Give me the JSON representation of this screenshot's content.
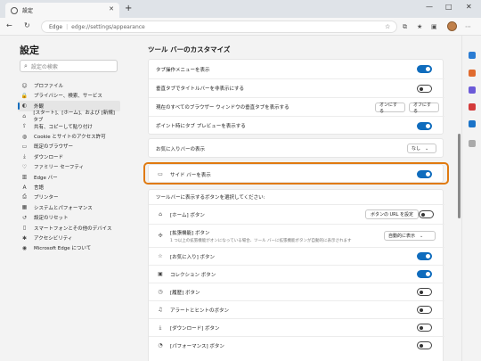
{
  "browser": {
    "tab_title": "設定",
    "address_site": "Edge",
    "address_url": "edge://settings/appearance"
  },
  "leftnav": {
    "title": "設定",
    "search_placeholder": "設定の検索",
    "items": [
      {
        "label": "プロファイル",
        "icon": "profile-icon",
        "active": false
      },
      {
        "label": "プライバシー、検索、サービス",
        "icon": "lock-icon",
        "active": false
      },
      {
        "label": "外観",
        "icon": "appearance-icon",
        "active": true
      },
      {
        "label": "[スタート]、[ホーム]、および [新規] タブ",
        "icon": "home-icon",
        "active": false
      },
      {
        "label": "共有、コピーして貼り付け",
        "icon": "share-icon",
        "active": false
      },
      {
        "label": "Cookie とサイトのアクセス許可",
        "icon": "cookie-icon",
        "active": false
      },
      {
        "label": "既定のブラウザー",
        "icon": "browser-icon",
        "active": false
      },
      {
        "label": "ダウンロード",
        "icon": "download-icon",
        "active": false
      },
      {
        "label": "ファミリー セーフティ",
        "icon": "family-icon",
        "active": false
      },
      {
        "label": "Edge バー",
        "icon": "edgebar-icon",
        "active": false
      },
      {
        "label": "言語",
        "icon": "language-icon",
        "active": false
      },
      {
        "label": "プリンター",
        "icon": "printer-icon",
        "active": false
      },
      {
        "label": "システムとパフォーマンス",
        "icon": "system-icon",
        "active": false
      },
      {
        "label": "設定のリセット",
        "icon": "reset-icon",
        "active": false
      },
      {
        "label": "スマートフォンとその他のデバイス",
        "icon": "phone-icon",
        "active": false
      },
      {
        "label": "アクセシビリティ",
        "icon": "accessibility-icon",
        "active": false
      },
      {
        "label": "Microsoft Edge について",
        "icon": "edge-icon",
        "active": false
      }
    ]
  },
  "main": {
    "title": "ツール バーのカスタマイズ",
    "tab_rows": [
      {
        "label": "タブ操作メニューを表示",
        "state": "on"
      },
      {
        "label": "垂直タブでタイトルバーを非表示にする",
        "state": "off"
      },
      {
        "label": "現在のすべてのブラウザー ウィンドウの垂直タブを表示する",
        "btn_on": "オンにする",
        "btn_off": "オフにする"
      },
      {
        "label": "ポイント時にタブ プレビューを表示する",
        "state": "on"
      }
    ],
    "favorites_bar": {
      "label": "お気に入りバーの表示",
      "value": "なし"
    },
    "sidebar_row": {
      "label": "サイド バーを表示",
      "state": "on"
    },
    "buttons_section": "ツールバーに表示するボタンを選択してください:",
    "button_rows": [
      {
        "label": "[ホーム] ボタン",
        "icon": "home-icon",
        "button": "ボタンの URL を設定",
        "state": "off"
      },
      {
        "label": "[拡張機能] ボタン",
        "icon": "extensions-icon",
        "sub": "1 つ以上の拡張機能がオンになっている場合、ツール バーに拡張機能ボタンが自動的に表示されます",
        "select": "自動的に表示"
      },
      {
        "label": "[お気に入り] ボタン",
        "icon": "favorites-icon",
        "state": "on"
      },
      {
        "label": "コレクション ボタン",
        "icon": "collections-icon",
        "state": "on"
      },
      {
        "label": "[履歴] ボタン",
        "icon": "history-icon",
        "state": "off"
      },
      {
        "label": "アラートとヒントのボタン",
        "icon": "bell-icon",
        "state": "off"
      },
      {
        "label": "[ダウンロード] ボタン",
        "icon": "download-icon",
        "state": "off"
      },
      {
        "label": "[パフォーマンス] ボタン",
        "icon": "performance-icon",
        "state": "off"
      }
    ]
  },
  "colors": {
    "accent": "#0f6cbd",
    "highlight": "#e07a10"
  }
}
